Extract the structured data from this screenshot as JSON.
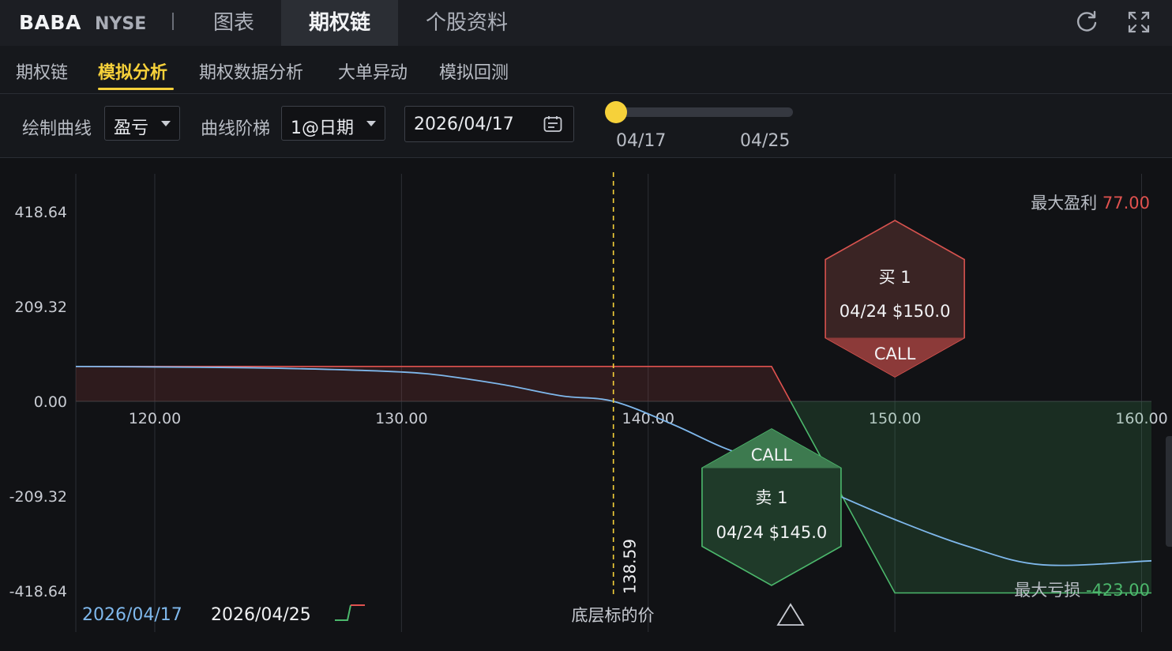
{
  "header": {
    "symbol": "BABA",
    "exchange": "NYSE",
    "tabs": [
      {
        "label": "图表",
        "active": false
      },
      {
        "label": "期权链",
        "active": true
      },
      {
        "label": "个股资料",
        "active": false
      }
    ],
    "icons": [
      "refresh-icon",
      "fullscreen-icon"
    ]
  },
  "subtabs": [
    {
      "label": "期权链",
      "active": false
    },
    {
      "label": "模拟分析",
      "active": true
    },
    {
      "label": "期权数据分析",
      "active": false
    },
    {
      "label": "大单异动",
      "active": false
    },
    {
      "label": "模拟回测",
      "active": false
    }
  ],
  "controls": {
    "curve_label": "绘制曲线",
    "curve_value": "盈亏",
    "step_label": "曲线阶梯",
    "step_value": "1@日期",
    "date_value": "2026/04/17",
    "slider_start": "04/17",
    "slider_end": "04/25",
    "slider_position": 0
  },
  "colors": {
    "background": "#111215",
    "accent": "#f6d13a",
    "profit": "#e0524f",
    "loss": "#4cb86c",
    "curve_today": "#7fb8ec",
    "grid": "#2c2f35"
  },
  "chart_data": {
    "type": "line",
    "xlim": [
      116.8,
      160.4
    ],
    "ylim": [
      -418.64,
      418.64
    ],
    "x_ticks": [
      "120.00",
      "130.00",
      "140.00",
      "150.00",
      "160.00"
    ],
    "x_tick_values": [
      120,
      130,
      140,
      150,
      160
    ],
    "y_ticks": [
      "418.64",
      "209.32",
      "0.00",
      "-209.32",
      "-418.64"
    ],
    "y_tick_values": [
      418.64,
      209.32,
      0,
      -209.32,
      -418.64
    ],
    "xlabel": "底层标的价",
    "series": [
      {
        "name": "2026/04/17",
        "x": [
          116.8,
          120,
          124,
          128,
          131,
          134,
          136.5,
          138.59,
          141,
          143,
          145,
          147,
          150,
          153,
          156,
          160.4
        ],
        "y": [
          77,
          76,
          74,
          69,
          61,
          38,
          12,
          0,
          -51,
          -101,
          -141,
          -191,
          -261,
          -321,
          -361,
          -352
        ]
      },
      {
        "name": "2026/04/25",
        "x": [
          116.8,
          145,
          150,
          160.4
        ],
        "y": [
          77,
          77,
          -423,
          -423
        ]
      }
    ],
    "spot_price": 138.59,
    "spot_label": "138.59",
    "max_profit_label": "最大盈利",
    "max_profit": "77.00",
    "max_loss_label": "最大亏损",
    "max_loss": "-423.00",
    "legs": [
      {
        "action": "买 1",
        "detail": "04/24 $150.0",
        "type": "CALL",
        "side": "buy"
      },
      {
        "action": "卖 1",
        "detail": "04/24 $145.0",
        "type": "CALL",
        "side": "sell"
      }
    ]
  }
}
